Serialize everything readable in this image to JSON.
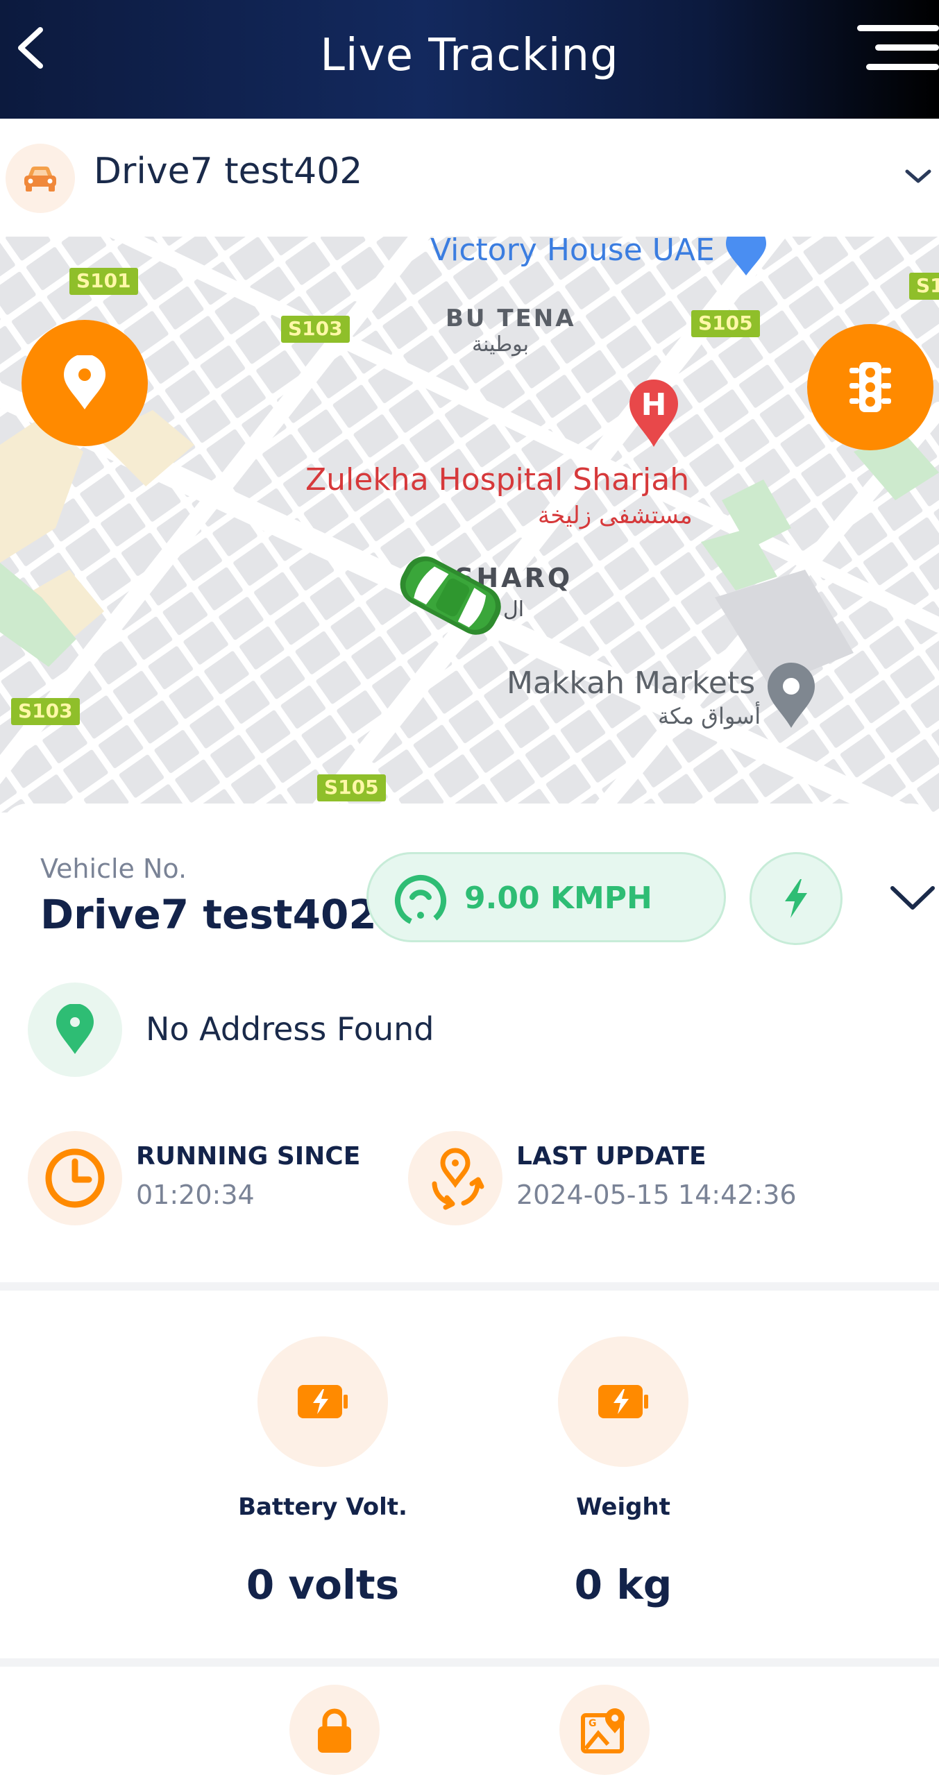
{
  "header": {
    "title": "Live Tracking"
  },
  "selector": {
    "vehicle_name": "Drive7 test402"
  },
  "map": {
    "labels": {
      "victory_house": "Victory House UAE",
      "bu_tena": "BU TENA",
      "bu_tena_ar": "بوطينة",
      "hospital": "Zulekha Hospital Sharjah",
      "hospital_ar": "مستشفى زليخة",
      "sharq": "SHARQ",
      "sharq_ar": "ال",
      "makkah": "Makkah Markets",
      "makkah_ar": "أسواق مكة"
    },
    "roads": {
      "s101": "S101",
      "s103_a": "S103",
      "s105_a": "S105",
      "s1": "S1",
      "s103_b": "S103",
      "s105_b": "S105"
    },
    "hospital_marker": "H"
  },
  "vehicle": {
    "caption": "Vehicle No.",
    "number": "Drive7 test402",
    "speed": "9.00 KMPH"
  },
  "address": {
    "text": "No Address Found"
  },
  "running": {
    "label": "RUNNING SINCE",
    "value": "01:20:34"
  },
  "last_update": {
    "label": "LAST UPDATE",
    "value": "2024-05-15 14:42:36"
  },
  "sensors": {
    "battery": {
      "label": "Battery Volt.",
      "value": "0 volts"
    },
    "weight": {
      "label": "Weight",
      "value": "0 kg"
    }
  },
  "colors": {
    "accent": "#ff8a00",
    "header_bg": "#0c1a3e",
    "speed_green": "#2ebd74",
    "vehicle_text": "#13234a"
  }
}
